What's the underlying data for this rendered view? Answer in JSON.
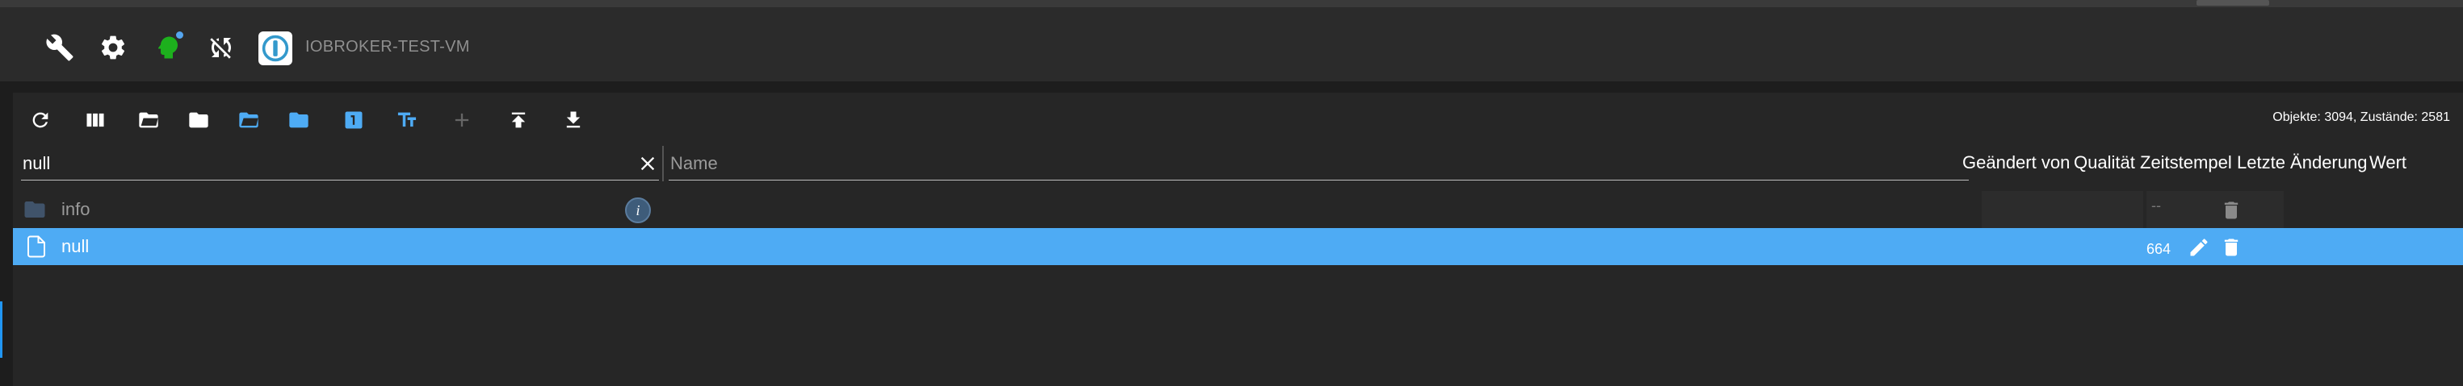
{
  "header": {
    "host_name": "IOBROKER-TEST-VM",
    "icons": [
      "wrench-icon",
      "settings-gear-icon",
      "expert-mode-head-icon",
      "sync-disabled-icon"
    ],
    "logo": "iobroker-logo"
  },
  "toolbar": {
    "buttons": [
      "refresh-icon",
      "columns-icon",
      "expand-all-icon",
      "collapse-all-icon",
      "expand-one-level-icon",
      "collapse-one-level-icon",
      "number-icon",
      "text-size-icon",
      "add-icon",
      "upload-icon",
      "download-icon"
    ],
    "stats": "Objekte: 3094, Zustände: 2581"
  },
  "filters": {
    "id_value": "null",
    "name_placeholder": "Name"
  },
  "columns": {
    "changed_by": "Geändert von",
    "quality": "Qualität",
    "timestamp": "Zeitstempel",
    "last_change": "Letzte Änderung",
    "value": "Wert"
  },
  "rows": [
    {
      "id": "info",
      "type": "folder-icon",
      "adapter_icon": "i",
      "dash": "--"
    },
    {
      "id": "null",
      "type": "file-icon",
      "value": "664",
      "selected": true
    }
  ],
  "colors": {
    "accent": "#4eabf4",
    "background": "#1d1d1d",
    "panel": "#262626",
    "header": "#2b2b2b",
    "expert_green": "#1db01d"
  }
}
